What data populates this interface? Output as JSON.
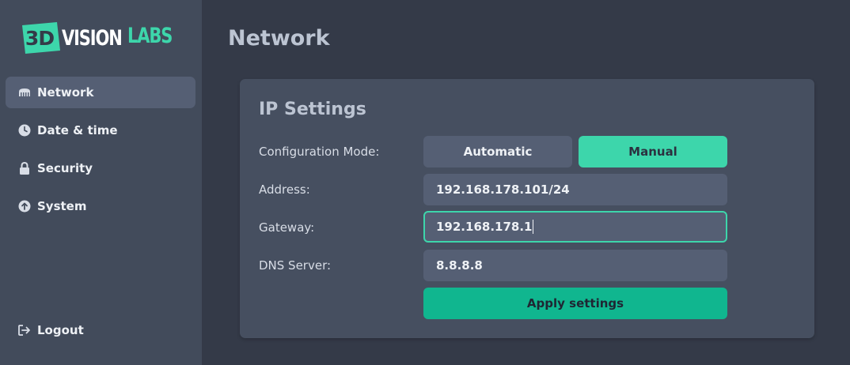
{
  "brand": {
    "badge_text": "3D",
    "word1": "VISION",
    "word2": "LABS",
    "colors": {
      "accent": "#3dd6ab",
      "text": "#ffffff"
    }
  },
  "sidebar": {
    "items": [
      {
        "label": "Network",
        "icon": "network-icon",
        "active": true
      },
      {
        "label": "Date & time",
        "icon": "clock-icon",
        "active": false
      },
      {
        "label": "Security",
        "icon": "lock-icon",
        "active": false
      },
      {
        "label": "System",
        "icon": "upload-circle-icon",
        "active": false
      }
    ],
    "logout_label": "Logout"
  },
  "page": {
    "title": "Network"
  },
  "ip_settings": {
    "title": "IP Settings",
    "config_mode_label": "Configuration Mode:",
    "mode_options": [
      "Automatic",
      "Manual"
    ],
    "selected_mode": "Manual",
    "address_label": "Address:",
    "address_value": "192.168.178.101/24",
    "gateway_label": "Gateway:",
    "gateway_value": "192.168.178.1",
    "dns_label": "DNS Server:",
    "dns_value": "8.8.8.8",
    "apply_label": "Apply settings"
  },
  "colors": {
    "background": "#343a48",
    "sidebar": "#424b5b",
    "card": "#464f60",
    "accent": "#3dd6ab",
    "apply": "#10b68f"
  }
}
